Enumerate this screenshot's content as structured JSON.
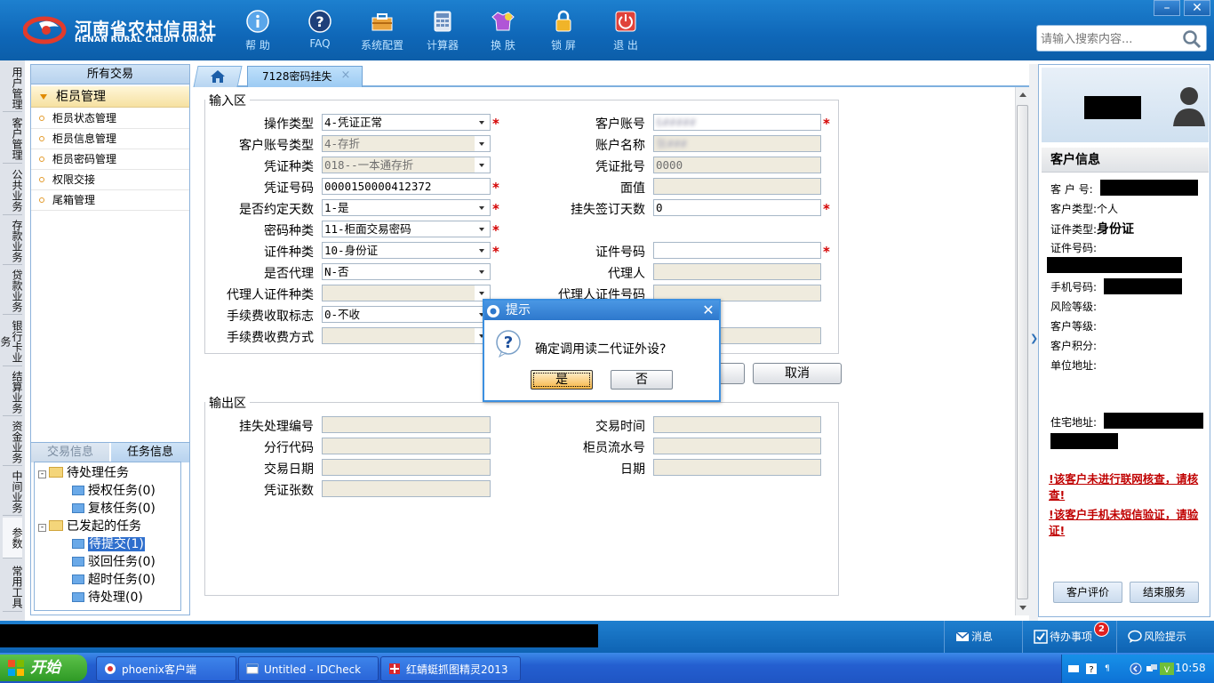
{
  "header": {
    "logo_cn": "河南省农村信用社",
    "logo_en": "HENAN RURAL CREDIT UNION",
    "toolbar": [
      {
        "label": "帮 助",
        "icon": "info-icon"
      },
      {
        "label": "FAQ",
        "icon": "question-icon"
      },
      {
        "label": "系统配置",
        "icon": "toolbox-icon"
      },
      {
        "label": "计算器",
        "icon": "calculator-icon"
      },
      {
        "label": "换 肤",
        "icon": "shirt-icon"
      },
      {
        "label": "锁 屏",
        "icon": "lock-icon"
      },
      {
        "label": "退 出",
        "icon": "power-icon"
      }
    ],
    "search_placeholder": "请输入搜索内容...",
    "win_min": "–",
    "win_close": "✕"
  },
  "vtabs": [
    "用户管理",
    "客户管理",
    "公共业务",
    "存款业务",
    "贷款业务",
    "银行卡业务",
    "结算业务",
    "资金业务",
    "中间业务",
    "参数",
    "常用工具"
  ],
  "nav": {
    "header": "所有交易",
    "group": "柜员管理",
    "items": [
      "柜员状态管理",
      "柜员信息管理",
      "柜员密码管理",
      "权限交接",
      "尾箱管理"
    ],
    "lower_tabs": [
      "交易信息",
      "任务信息"
    ],
    "tree": {
      "pending": "待处理任务",
      "pending_children": [
        "授权任务(0)",
        "复核任务(0)"
      ],
      "initiated": "已发起的任务",
      "initiated_children": [
        "待提交(1)",
        "驳回任务(0)",
        "超时任务(0)",
        "待处理(0)"
      ]
    }
  },
  "tabs": {
    "active_label": "7128密码挂失",
    "close": "×"
  },
  "input_section": {
    "title": "输入区",
    "left_fields": [
      {
        "label": "操作类型",
        "value": "4-凭证正常"
      },
      {
        "label": "客户账号类型",
        "value": "4-存折"
      },
      {
        "label": "凭证种类",
        "value": "018--一本通存折"
      },
      {
        "label": "凭证号码",
        "value": "0000150000412372"
      },
      {
        "label": "是否约定天数",
        "value": "1-是"
      },
      {
        "label": "密码种类",
        "value": "11-柜面交易密码"
      },
      {
        "label": "证件种类",
        "value": "10-身份证"
      },
      {
        "label": "是否代理",
        "value": "N-否"
      },
      {
        "label": "代理人证件种类",
        "value": ""
      },
      {
        "label": "手续费收取标志",
        "value": "0-不收"
      },
      {
        "label": "手续费收费方式",
        "value": ""
      }
    ],
    "right_fields": [
      {
        "label": "客户账号",
        "value": "6#####"
      },
      {
        "label": "账户名称",
        "value": "张###"
      },
      {
        "label": "凭证批号",
        "value": "0000"
      },
      {
        "label": "面值",
        "value": ""
      },
      {
        "label": "挂失签订天数",
        "value": "0"
      },
      {
        "label": "证件号码",
        "value": ""
      },
      {
        "label": "代理人",
        "value": ""
      },
      {
        "label": "代理人证件号码",
        "value": ""
      }
    ],
    "required_mark": "*",
    "cancel_label": "取消"
  },
  "output_section": {
    "title": "输出区",
    "left_fields": [
      "挂失处理编号",
      "分行代码",
      "交易日期",
      "凭证张数"
    ],
    "right_fields": [
      "交易时间",
      "柜员流水号",
      "日期"
    ]
  },
  "customer": {
    "title": "客户信息",
    "labels": [
      "客 户 号:",
      "客户类型:",
      "证件类型:",
      "证件号码:",
      "手机号码:",
      "风险等级:",
      "客户等级:",
      "客户积分:",
      "单位地址:",
      "住宅地址:"
    ],
    "customer_type": "个人",
    "id_type": "身份证",
    "warnings": [
      "!该客户未进行联网核查，请核查!",
      "!该客户手机未短信验证，请验证!"
    ],
    "buttons": [
      "客户评价",
      "结束服务"
    ]
  },
  "statusbar": {
    "message": "消息",
    "todo": "待办事项",
    "todo_count": "2",
    "risk": "风险提示"
  },
  "taskbar": {
    "start": "开始",
    "tasks": [
      "phoenix客户端",
      "Untitled - IDCheck",
      "红蜻蜓抓图精灵2013"
    ],
    "clock": "10:58"
  },
  "dialog": {
    "title": "提示",
    "message": "确定调用读二代证外设?",
    "yes": "是",
    "no": "否",
    "close": "✕"
  }
}
